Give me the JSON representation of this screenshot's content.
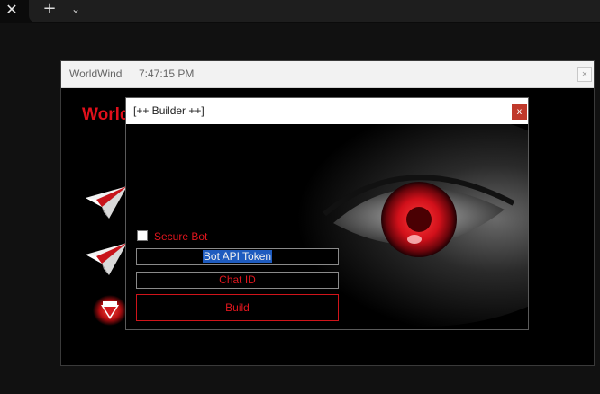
{
  "tabbar": {
    "close_glyph": "✕",
    "new_tab_glyph": "+",
    "dropdown_glyph": "⌄"
  },
  "main_window": {
    "title": "WorldWind",
    "time": "7:47:15 PM",
    "brand_partial": "World",
    "close_glyph": "✕",
    "icons": [
      "paper-plane-icon",
      "paper-plane-icon",
      "certificate-icon"
    ]
  },
  "builder": {
    "title": "[++ Builder ++]",
    "close_glyph": "x",
    "secure_bot_label": "Secure Bot",
    "secure_bot_checked": false,
    "token_value": "Bot API Token",
    "chat_id_value": "Chat ID",
    "build_label": "Build"
  },
  "colors": {
    "accent_red": "#e0161e",
    "selection_blue": "#1e5bbf",
    "background": "#000000"
  }
}
